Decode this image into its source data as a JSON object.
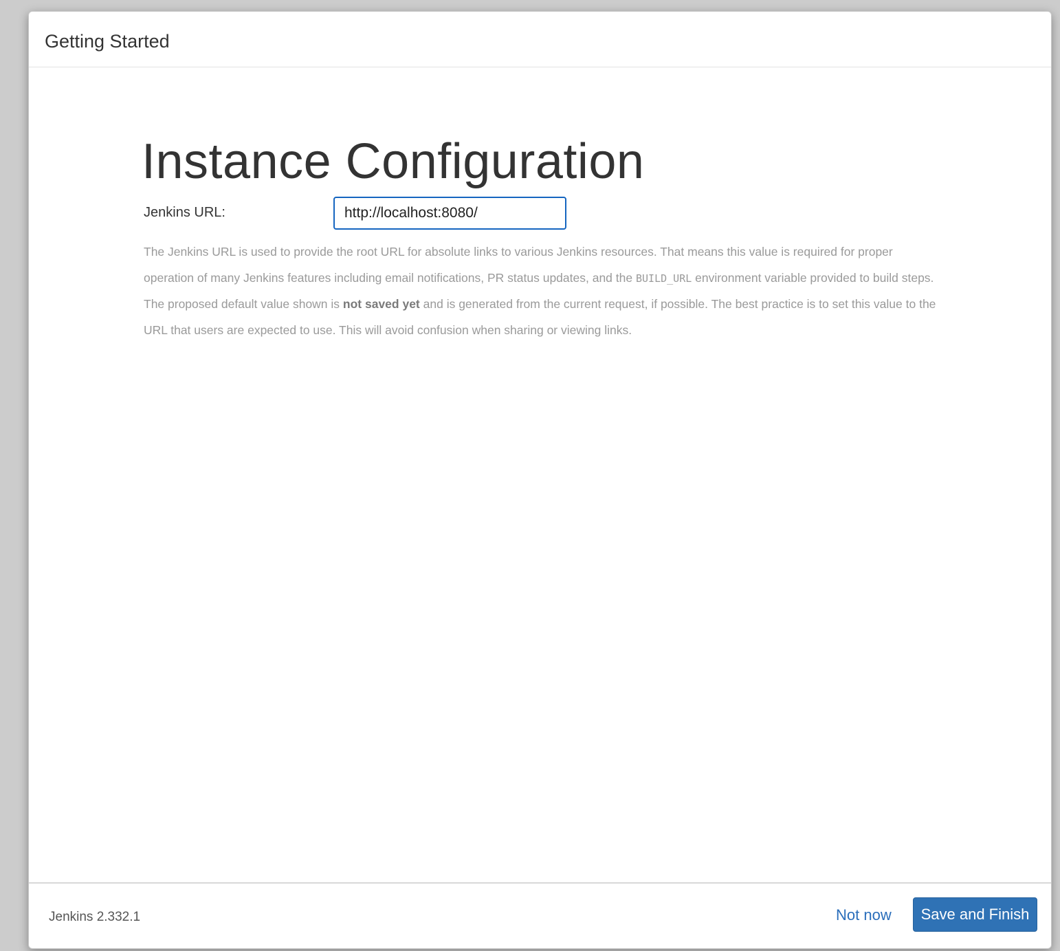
{
  "dialog": {
    "title": "Getting Started"
  },
  "main": {
    "heading": "Instance Configuration",
    "url_label": "Jenkins URL:",
    "url_value": "http://localhost:8080/",
    "help": {
      "p1_before_code": "The Jenkins URL is used to provide the root URL for absolute links to various Jenkins resources. That means this value is required for proper operation of many Jenkins features including email notifications, PR status updates, and the ",
      "p1_code": "BUILD_URL",
      "p1_after_code": " environment variable provided to build steps.",
      "p2_before_bold": "The proposed default value shown is ",
      "p2_bold": "not saved yet",
      "p2_after_bold": " and is generated from the current request, if possible. The best practice is to set this value to the URL that users are expected to use. This will avoid confusion when sharing or viewing links."
    }
  },
  "footer": {
    "version": "Jenkins 2.332.1",
    "not_now_label": "Not now",
    "save_finish_label": "Save and Finish"
  },
  "colors": {
    "primary_button": "#2f72b5",
    "link": "#2a6ebb",
    "input_focus_border": "#1565c0"
  }
}
